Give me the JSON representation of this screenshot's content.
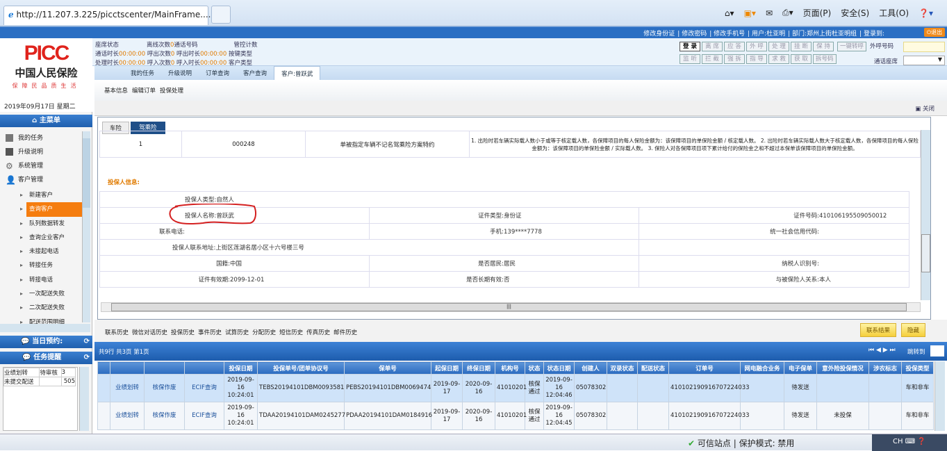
{
  "browser": {
    "tab_title": "http://11.207.3.225/picctscenter/MainFrame....",
    "tools": [
      "页面(P)",
      "安全(S)",
      "工具(O)"
    ]
  },
  "topbar": {
    "links": [
      "修改身份证",
      "修改密码",
      "修改手机号",
      "用户:杜亚明",
      "部门:郑州上街杜亚明组",
      "登录到:"
    ],
    "exit": "退出"
  },
  "logo": {
    "brand": "PICC",
    "name": "中国人民保险",
    "slogan": "保障民品质生活"
  },
  "status_info": {
    "row1": [
      {
        "l": "座席状态",
        "v": ""
      },
      {
        "l": "离线次数",
        "v": "0"
      },
      {
        "l": "通话号码",
        "v": ""
      },
      {
        "l": "管控计数",
        "v": ""
      }
    ],
    "row2": [
      {
        "l": "通话时长",
        "v": "00:00:00"
      },
      {
        "l": "呼出次数",
        "v": "0"
      },
      {
        "l": "呼出时长",
        "v": "00:00:00"
      },
      {
        "l": "按键类型",
        "v": ""
      }
    ],
    "row3": [
      {
        "l": "处理时长",
        "v": "00:00:00"
      },
      {
        "l": "呼入次数",
        "v": "0"
      },
      {
        "l": "呼入时长",
        "v": "00:00:00"
      },
      {
        "l": "客户类型",
        "v": ""
      }
    ]
  },
  "phone_buttons": {
    "row1": [
      "登 录",
      "离 席",
      "应 答",
      "外 呼",
      "处 理",
      "挂 断",
      "保 持",
      "一键转呼"
    ],
    "row2": [
      "监 听",
      "拦 截",
      "强 拆",
      "指 导",
      "求 救",
      "获 取",
      "拆号码"
    ],
    "out_number_label": "外呼号码",
    "seat_label": "通话座席"
  },
  "nav_tabs": [
    "我的任务",
    "升级说明",
    "订单查询",
    "客户查询",
    "客户:曾跃武"
  ],
  "sub_nav": [
    "基本信息",
    "编辑订单",
    "投保处理"
  ],
  "close_label": "关闭",
  "sidebar": {
    "date": "2019年09月17日 星期二",
    "menu_title": "主菜单",
    "items": [
      "我的任务",
      "升级说明",
      "系统管理",
      "客户管理"
    ],
    "sub_items": [
      "新建客户",
      "查询客户",
      "队列数据转发",
      "查询企业客户",
      "未接起电话",
      "转接任务",
      "转接电话",
      "一次配送失败",
      "二次配送失败",
      "配送范围明细"
    ],
    "appointment": "当日预约:",
    "reminder": "任务提醒",
    "reminder_rows": [
      [
        "业绩划转",
        "待审核",
        "3"
      ],
      [
        "未提交配送",
        "",
        "505"
      ]
    ]
  },
  "panel": {
    "tabs": [
      "车险",
      "驾乘险"
    ],
    "clause_row": [
      "1",
      "000248",
      "单被指定车辆不记名驾乘险方案特约",
      "1. 出险时若车辆实际载人数小于或等于核定载人数，各保障项目的每人保险金额为：该保障项目的单保险金额 / 核定载人数。 2. 出险时若车辆实际载人数大于核定载人数，各保障项目的每人保险金额为：该保障项目的单保险金额 / 实际载人数。 3. 保险人对各保障项目项下累计给付的保险金之和不超过本保单该保障项目的单保险金额。"
    ],
    "section_title": "投保人信息:",
    "fields": [
      [
        [
          "投保人类型:",
          "自然人"
        ]
      ],
      [
        [
          "投保人名称:",
          "曾跃武"
        ],
        [
          "证件类型:",
          "身份证"
        ],
        [
          "证件号码:",
          "410106195509050012"
        ]
      ],
      [
        [
          "联系电话:",
          ""
        ],
        [
          "手机:",
          "139****7778"
        ],
        [
          "统一社会信用代码:",
          ""
        ]
      ],
      [
        [
          "投保人联系地址:",
          "上街区莲湖名居小区十六号楼三号"
        ]
      ],
      [
        [
          "国籍:",
          "中国"
        ],
        [
          "是否居民:",
          "居民"
        ],
        [
          "纳税人识别号:",
          ""
        ]
      ],
      [
        [
          "证件有效期:",
          "2099-12-01"
        ],
        [
          "是否长期有效:",
          "否"
        ],
        [
          "与被保险人关系:",
          "本人"
        ]
      ]
    ]
  },
  "history_tabs": [
    "联系历史",
    "微信对话历史",
    "投保历史",
    "事件历史",
    "试算历史",
    "分配历史",
    "短信历史",
    "传真历史",
    "邮件历史"
  ],
  "buttons": {
    "contact_result": "联系结果",
    "hide": "隐藏"
  },
  "pager": {
    "summary": "共9行 共3页 第1页",
    "jump": "跳转到"
  },
  "grid": {
    "headers": [
      "",
      "",
      "",
      "",
      "投保日期",
      "投保单号/团单协议号",
      "保单号",
      "起保日期",
      "终保日期",
      "机构号",
      "状态",
      "状态日期",
      "创建人",
      "双录状态",
      "配送状态",
      "订单号",
      "网电融合业务",
      "电子保单",
      "意外险投保情况",
      "涉农标志",
      "投保类型"
    ],
    "rows": [
      [
        "",
        "业绩划转",
        "核保作废",
        "ECIF查询",
        "2019-09-16 10:24:01",
        "TEBS20194101DBM0093581",
        "PEBS20194101DBM0069474",
        "2019-09-17",
        "2020-09-16",
        "41010201",
        "核保通过",
        "2019-09-16 12:04:46",
        "05078302",
        "",
        "",
        "410102190916707224033",
        "",
        "待发送",
        "",
        "",
        "车和非车"
      ],
      [
        "",
        "业绩划转",
        "核保作废",
        "ECIF查询",
        "2019-09-16 10:24:01",
        "TDAA20194101DAM0245277",
        "PDAA20194101DAM0184916",
        "2019-09-17",
        "2020-09-16",
        "41010201",
        "核保通过",
        "2019-09-16 12:04:45",
        "05078302",
        "",
        "",
        "410102190916707224033",
        "",
        "待发送",
        "未投保",
        "",
        "车和非车"
      ]
    ]
  },
  "statusbar": {
    "zone": "可信站点 | 保护模式: 禁用",
    "lang": "CH"
  }
}
